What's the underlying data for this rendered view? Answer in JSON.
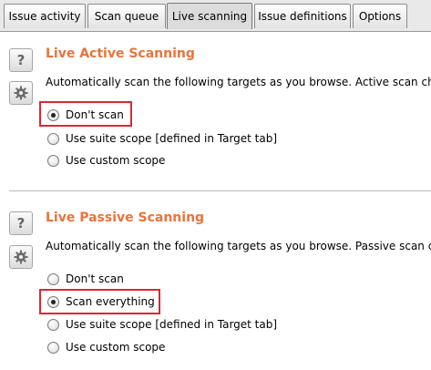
{
  "tabs": [
    {
      "label": "Issue activity"
    },
    {
      "label": "Scan queue"
    },
    {
      "label": "Live scanning",
      "active": true
    },
    {
      "label": "Issue definitions"
    },
    {
      "label": "Options"
    }
  ],
  "active_scan": {
    "title": "Live Active Scanning",
    "description": "Automatically scan the following targets as you browse. Active scan che",
    "options": [
      {
        "label": "Don't scan",
        "checked": true
      },
      {
        "label": "Use suite scope [defined in Target tab]",
        "checked": false
      },
      {
        "label": "Use custom scope",
        "checked": false
      }
    ]
  },
  "passive_scan": {
    "title": "Live Passive Scanning",
    "description": "Automatically scan the following targets as you browse. Passive scan che",
    "options": [
      {
        "label": "Don't scan",
        "checked": false
      },
      {
        "label": "Scan everything",
        "checked": true
      },
      {
        "label": "Use suite scope [defined in Target tab]",
        "checked": false
      },
      {
        "label": "Use custom scope",
        "checked": false
      }
    ]
  },
  "icons": {
    "help": "help-icon",
    "settings": "gear-icon"
  },
  "colors": {
    "heading": "#e8743b",
    "highlight": "#e0262f"
  }
}
